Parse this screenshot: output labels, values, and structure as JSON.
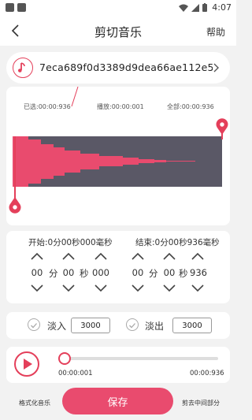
{
  "status_bar": {
    "time": "4:07"
  },
  "nav": {
    "title": "剪切音乐",
    "help": "帮助"
  },
  "file": {
    "name": "7eca689f0d3389d9dea66ae112e5..."
  },
  "waveform": {
    "selected": "已选:00:00:936",
    "playing": "播放:00:00:001",
    "total": "全部:00:00:936"
  },
  "start": {
    "label": "开始:0分00秒000毫秒",
    "minutes": "00",
    "seconds": "00",
    "millis": "000",
    "min_unit": "分",
    "sec_unit": "秒"
  },
  "end": {
    "label": "结束:0分00秒936毫秒",
    "minutes": "00",
    "seconds": "00",
    "millis": "936",
    "min_unit": "分",
    "sec_unit": "秒"
  },
  "fade_in": {
    "label": "淡入",
    "value": "3000"
  },
  "fade_out": {
    "label": "淡出",
    "value": "3000"
  },
  "player": {
    "current": "00:00:001",
    "total": "00:00:936",
    "progress": 0.0
  },
  "bottom": {
    "format": "格式化音乐",
    "save": "保存",
    "cut_middle": "剪去中间部分"
  },
  "colors": {
    "accent": "#e43f5a",
    "waveform_bg": "#5a5866",
    "save_button": "#e94b6e"
  }
}
